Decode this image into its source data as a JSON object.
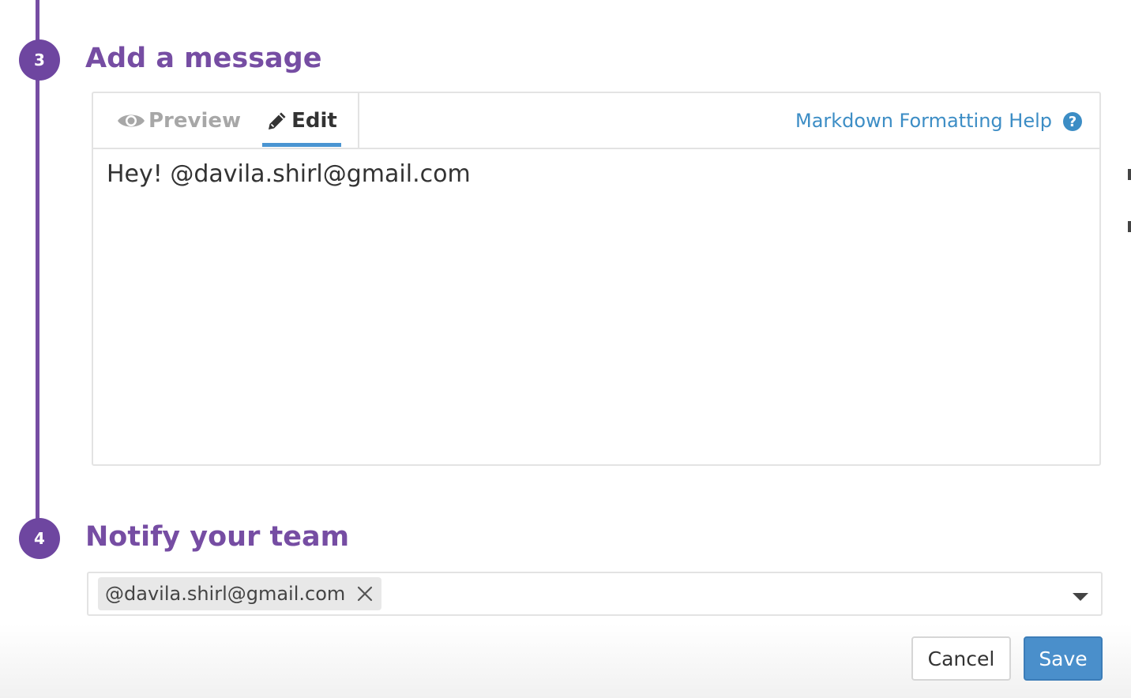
{
  "steps": [
    {
      "number": "3",
      "heading": "Add a message"
    },
    {
      "number": "4",
      "heading": "Notify your team"
    }
  ],
  "editor": {
    "tabs": {
      "preview_label": "Preview",
      "edit_label": "Edit",
      "active": "edit"
    },
    "help_link": "Markdown Formatting Help",
    "help_icon": "?",
    "message": "Hey! @davila.shirl@gmail.com"
  },
  "notify": {
    "recipients": [
      "@davila.shirl@gmail.com"
    ]
  },
  "actions": {
    "cancel_label": "Cancel",
    "save_label": "Save"
  },
  "colors": {
    "accent_purple": "#764da3",
    "link_blue": "#3c8dc5",
    "primary_button": "#4a8fcb"
  },
  "icons": {
    "preview_tab": "eye-icon",
    "edit_tab": "pencil-icon",
    "help": "question-circle-icon",
    "remove_chip": "close-icon",
    "dropdown": "chevron-down-icon"
  }
}
